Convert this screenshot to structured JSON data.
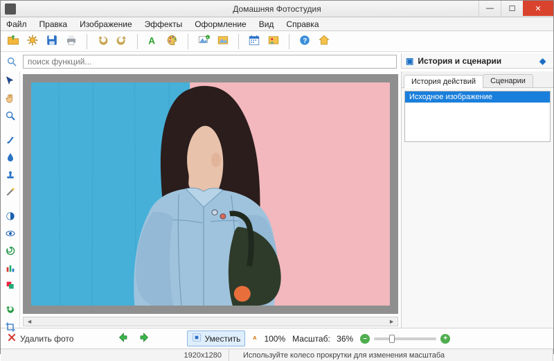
{
  "app": {
    "title": "Домашняя Фотостудия"
  },
  "menu": {
    "file": "Файл",
    "edit": "Правка",
    "image": "Изображение",
    "effects": "Эффекты",
    "design": "Оформление",
    "view": "Вид",
    "help": "Справка"
  },
  "search": {
    "placeholder": "поиск функций..."
  },
  "right": {
    "panel_title": "История и сценарии",
    "tab_history": "История действий",
    "tab_scenarios": "Сценарии",
    "history_item0": "Исходное изображение"
  },
  "bottom": {
    "delete": "Удалить фото",
    "fit": "Уместить",
    "hundred": "100%",
    "scale_label": "Масштаб:",
    "scale_value": "36%"
  },
  "status": {
    "dims": "1920x1280",
    "hint": "Используйте колесо прокрутки для изменения масштаба"
  }
}
